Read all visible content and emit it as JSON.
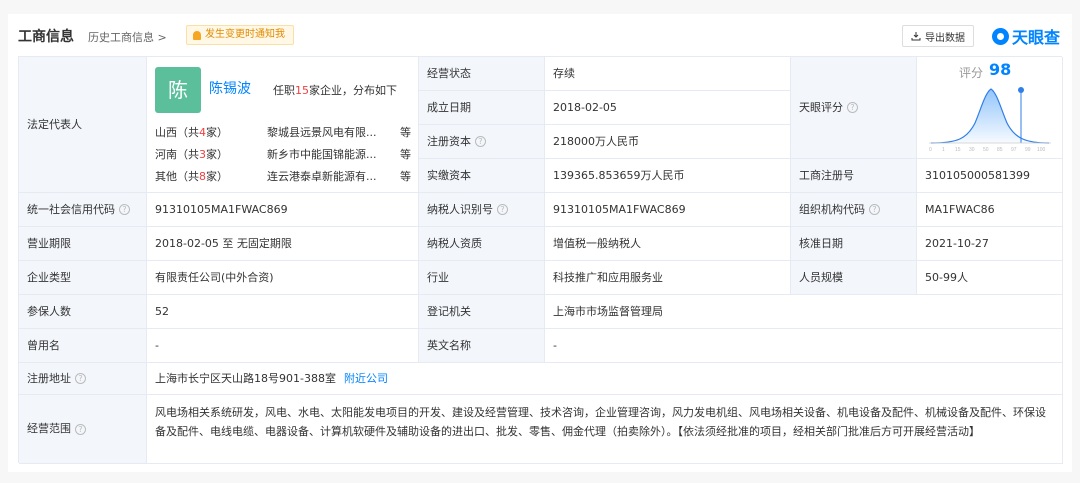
{
  "header": {
    "title": "工商信息",
    "history_link": "历史工商信息 >",
    "notify_button": "发生变更时通知我",
    "export_button": "导出数据",
    "logo_text": "天眼查"
  },
  "legal_rep": {
    "label": "法定代表人",
    "avatar_char": "陈",
    "name": "陈锡波",
    "summary_prefix": "任职",
    "company_count": "15",
    "summary_suffix": "家企业，分布如下",
    "regions": [
      {
        "region": "山西（共",
        "count": "4",
        "suffix": "家）",
        "company": "黎城县远景风电有限...",
        "more": "等"
      },
      {
        "region": "河南（共",
        "count": "3",
        "suffix": "家）",
        "company": "新乡市中能国锦能源...",
        "more": "等"
      },
      {
        "region": "其他（共",
        "count": "8",
        "suffix": "家）",
        "company": "连云港泰卓新能源有...",
        "more": "等"
      }
    ]
  },
  "fields": {
    "status_label": "经营状态",
    "status_value": "存续",
    "founded_label": "成立日期",
    "founded_value": "2018-02-05",
    "capital_label": "注册资本",
    "capital_value": "218000万人民币",
    "paidin_label": "实缴资本",
    "paidin_value": "139365.853659万人民币",
    "score_label": "天眼评分",
    "score_title": "评分",
    "score_value": "98",
    "score_ticks": [
      "0",
      "1",
      "15",
      "30",
      "50",
      "85",
      "97",
      "99",
      "100"
    ],
    "regno_label": "工商注册号",
    "regno_value": "310105000581399",
    "credit_label": "统一社会信用代码",
    "credit_value": "91310105MA1FWAC869",
    "taxid_label": "纳税人识别号",
    "taxid_value": "91310105MA1FWAC869",
    "orgcode_label": "组织机构代码",
    "orgcode_value": "MA1FWAC86",
    "term_label": "营业期限",
    "term_value": "2018-02-05 至 无固定期限",
    "taxtype_label": "纳税人资质",
    "taxtype_value": "增值税一般纳税人",
    "approve_label": "核准日期",
    "approve_value": "2021-10-27",
    "type_label": "企业类型",
    "type_value": "有限责任公司(中外合资)",
    "industry_label": "行业",
    "industry_value": "科技推广和应用服务业",
    "staff_label": "人员规模",
    "staff_value": "50-99人",
    "insured_label": "参保人数",
    "insured_value": "52",
    "authority_label": "登记机关",
    "authority_value": "上海市市场监督管理局",
    "formername_label": "曾用名",
    "formername_value": "-",
    "engname_label": "英文名称",
    "engname_value": "-",
    "address_label": "注册地址",
    "address_value": "上海市长宁区天山路18号901-388室",
    "nearby_link": "附近公司",
    "scope_label": "经营范围",
    "scope_value": "风电场相关系统研发，风电、水电、太阳能发电项目的开发、建设及经营管理、技术咨询，企业管理咨询，风力发电机组、风电场相关设备、机电设备及配件、机械设备及配件、环保设备及配件、电线电缆、电器设备、计算机软硬件及辅助设备的进出口、批发、零售、佣金代理（拍卖除外）。【依法须经批准的项目，经相关部门批准后方可开展经营活动】"
  },
  "colors": {
    "accent": "#0084ff",
    "label_bg": "#f3f6fb",
    "border": "#e6eaf2",
    "red": "#f04142"
  }
}
